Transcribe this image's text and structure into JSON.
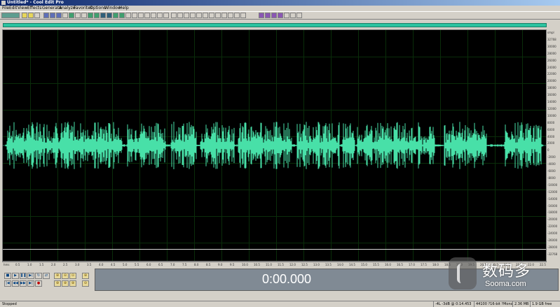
{
  "window": {
    "title": "Untitled* - Cool Edit Pro"
  },
  "menu": [
    "File",
    "Edit",
    "View",
    "Effects",
    "Generate",
    "Analyze",
    "Favorites",
    "Options",
    "Window",
    "Help"
  ],
  "colors": {
    "waveform": "#48e0a8",
    "background": "#000000",
    "overview_bar": "#2bc4a0"
  },
  "vertical_ruler": [
    "smpl",
    "32768",
    "30000",
    "28000",
    "26000",
    "24000",
    "22000",
    "20000",
    "18000",
    "16000",
    "14000",
    "12000",
    "10000",
    "8000",
    "6000",
    "4000",
    "2000",
    "0",
    "-2000",
    "-4000",
    "-6000",
    "-8000",
    "-10000",
    "-12000",
    "-14000",
    "-16000",
    "-18000",
    "-20000",
    "-22000",
    "-24000",
    "-26000",
    "-28000",
    "-32768"
  ],
  "horizontal_ruler": [
    "hms",
    "0.5",
    "1.0",
    "1.5",
    "2.0",
    "2.5",
    "3.0",
    "3.5",
    "4.0",
    "4.5",
    "5.0",
    "5.5",
    "6.0",
    "6.5",
    "7.0",
    "7.5",
    "8.0",
    "8.5",
    "9.0",
    "9.5",
    "10.0",
    "10.5",
    "11.0",
    "11.5",
    "12.0",
    "12.5",
    "13.0",
    "13.5",
    "14.0",
    "14.5",
    "15.0",
    "15.5",
    "16.0",
    "16.5",
    "17.0",
    "17.5",
    "18.0",
    "18.5",
    "19.0",
    "19.5",
    "20.0",
    "20.5",
    "21.0",
    "21.5",
    "22.0",
    "22.5"
  ],
  "transport": {
    "time_display": "0:00.000"
  },
  "status": {
    "state": "Stopped",
    "level": "-4L -3dB @ 0:14.453",
    "format": "44100 ?16-bit ?Mono",
    "size": "2.36 MB",
    "free": "1.9 GB free"
  },
  "watermark": {
    "brand_cn": "数码多",
    "brand_en": "Sooma.com"
  }
}
